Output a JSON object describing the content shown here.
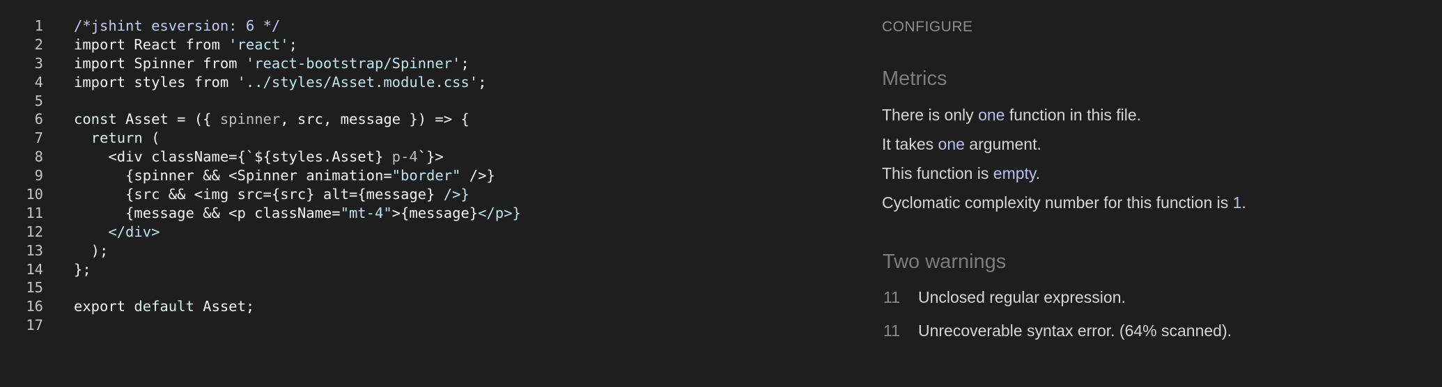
{
  "editor": {
    "lines": [
      {
        "number": "1",
        "tokens": [
          {
            "t": "/*jshint esversion: 6 */",
            "k": "comment"
          }
        ]
      },
      {
        "number": "2",
        "tokens": [
          {
            "t": "import React from ",
            "k": "plain"
          },
          {
            "t": "'react'",
            "k": "string"
          },
          {
            "t": ";",
            "k": "plain"
          }
        ]
      },
      {
        "number": "3",
        "tokens": [
          {
            "t": "import Spinner from ",
            "k": "plain"
          },
          {
            "t": "'react-bootstrap/Spinner'",
            "k": "string"
          },
          {
            "t": ";",
            "k": "plain"
          }
        ]
      },
      {
        "number": "4",
        "tokens": [
          {
            "t": "import styles from ",
            "k": "plain"
          },
          {
            "t": "'../styles/Asset.module.css'",
            "k": "string"
          },
          {
            "t": ";",
            "k": "plain"
          }
        ]
      },
      {
        "number": "5",
        "tokens": []
      },
      {
        "number": "6",
        "tokens": [
          {
            "t": "const",
            "k": "keyword"
          },
          {
            "t": " Asset = ({ ",
            "k": "plain"
          },
          {
            "t": "spinner",
            "k": "muted"
          },
          {
            "t": ", src, message }) => {",
            "k": "plain"
          }
        ]
      },
      {
        "number": "7",
        "tokens": [
          {
            "t": "  return",
            "k": "keyword"
          },
          {
            "t": " (",
            "k": "plain"
          }
        ]
      },
      {
        "number": "8",
        "tokens": [
          {
            "t": "    <div className={`${styles.Asset} ",
            "k": "plain"
          },
          {
            "t": "p-4",
            "k": "muted"
          },
          {
            "t": "`}>",
            "k": "plain"
          }
        ]
      },
      {
        "number": "9",
        "tokens": [
          {
            "t": "      {spinner && <Spinner animation=",
            "k": "plain"
          },
          {
            "t": "\"border\"",
            "k": "string"
          },
          {
            "t": " />}",
            "k": "plain"
          }
        ]
      },
      {
        "number": "10",
        "tokens": [
          {
            "t": "      {src && <img src={src} alt={message} ",
            "k": "plain"
          },
          {
            "t": "/>}",
            "k": "tag"
          }
        ]
      },
      {
        "number": "11",
        "tokens": [
          {
            "t": "      {message && <p className=",
            "k": "plain"
          },
          {
            "t": "\"mt-4\"",
            "k": "string"
          },
          {
            "t": ">{message}",
            "k": "plain"
          },
          {
            "t": "</p>}",
            "k": "tag"
          }
        ]
      },
      {
        "number": "12",
        "tokens": [
          {
            "t": "    </div>",
            "k": "tag"
          }
        ]
      },
      {
        "number": "13",
        "tokens": [
          {
            "t": "  );",
            "k": "plain"
          }
        ]
      },
      {
        "number": "14",
        "tokens": [
          {
            "t": "};",
            "k": "plain"
          }
        ]
      },
      {
        "number": "15",
        "tokens": []
      },
      {
        "number": "16",
        "tokens": [
          {
            "t": "export",
            "k": "plain"
          },
          {
            "t": " default",
            "k": "keyword"
          },
          {
            "t": " Asset;",
            "k": "plain"
          }
        ]
      },
      {
        "number": "17",
        "tokens": []
      }
    ]
  },
  "panel": {
    "configure_label": "CONFIGURE",
    "metrics_title": "Metrics",
    "metrics": {
      "functions": {
        "pre": "There is only ",
        "hl": "one",
        "post": " function in this file."
      },
      "arguments": {
        "pre": "It takes ",
        "hl": "one",
        "post": " argument."
      },
      "empty": {
        "pre": "This function is ",
        "hl": "empty",
        "post": "."
      },
      "complexity": {
        "pre": "Cyclomatic complexity number for this function is ",
        "hl": "1",
        "post": "."
      }
    },
    "warnings_title": "Two warnings",
    "warnings": [
      {
        "line": "11",
        "text": "Unclosed regular expression."
      },
      {
        "line": "11",
        "text": "Unrecoverable syntax error. (64% scanned)."
      }
    ]
  },
  "colors": {
    "background": "#1e1e1e",
    "comment": "#c2c8f5",
    "keyword": "#d7f2e3",
    "string": "#bde4ee",
    "highlight": "#b7bff0"
  }
}
